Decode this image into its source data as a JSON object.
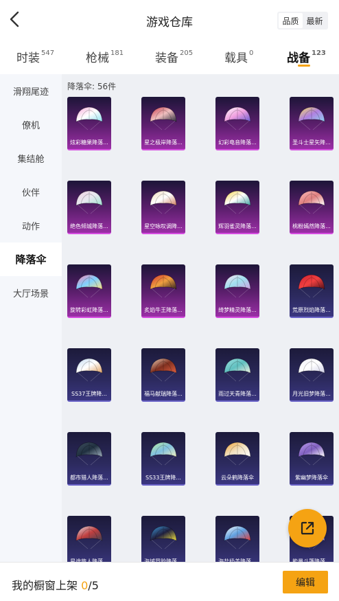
{
  "header": {
    "title": "游戏仓库",
    "sort": [
      "品质",
      "最新"
    ]
  },
  "tabs": [
    {
      "label": "时装",
      "count": "547"
    },
    {
      "label": "枪械",
      "count": "181"
    },
    {
      "label": "装备",
      "count": "205"
    },
    {
      "label": "载具",
      "count": "0"
    },
    {
      "label": "战备",
      "count": "123"
    }
  ],
  "sidebar": [
    {
      "label": "滑翔尾迹"
    },
    {
      "label": "僚机"
    },
    {
      "label": "集结舱"
    },
    {
      "label": "伙伴"
    },
    {
      "label": "动作"
    },
    {
      "label": "降落伞"
    },
    {
      "label": "大厅场景"
    }
  ],
  "content": {
    "count_label": "降落伞: 56件",
    "items": [
      {
        "name": "炫彩糖果降落...",
        "rarity": "purple"
      },
      {
        "name": "星之极岸降落...",
        "rarity": "purple"
      },
      {
        "name": "幻彩电音降落...",
        "rarity": "purple"
      },
      {
        "name": "圣斗士星矢降...",
        "rarity": "purple"
      },
      {
        "name": "绝色倾城降落...",
        "rarity": "purple"
      },
      {
        "name": "星空咏叹调降...",
        "rarity": "purple"
      },
      {
        "name": "辉羽雀灵降落...",
        "rarity": "purple"
      },
      {
        "name": "桃粉嫣然降落...",
        "rarity": "purple"
      },
      {
        "name": "旋转彩虹降落...",
        "rarity": "purple"
      },
      {
        "name": "炙焰牛王降落...",
        "rarity": "purple"
      },
      {
        "name": "绮梦精灵降落...",
        "rarity": "purple"
      },
      {
        "name": "荒原烈焰降落...",
        "rarity": "blue"
      },
      {
        "name": "SS37王牌降...",
        "rarity": "blue"
      },
      {
        "name": "福马献瑞降落...",
        "rarity": "blue"
      },
      {
        "name": "雨过天青降落...",
        "rarity": "blue"
      },
      {
        "name": "月光旧梦降落...",
        "rarity": "blue"
      },
      {
        "name": "都市猎人降落...",
        "rarity": "blue"
      },
      {
        "name": "SS33王牌降...",
        "rarity": "blue"
      },
      {
        "name": "云朵鹤降落伞",
        "rarity": "blue"
      },
      {
        "name": "紫幽梦降落伞",
        "rarity": "blue"
      },
      {
        "name": "星途旅人降落...",
        "rarity": "blue"
      },
      {
        "name": "海域冒险降落...",
        "rarity": "blue"
      },
      {
        "name": "海盐奶盖降落...",
        "rarity": "blue"
      },
      {
        "name": "能量斗篷降落...",
        "rarity": "blue"
      }
    ]
  },
  "footer": {
    "label": "我的橱窗上架",
    "current": "0",
    "total": "/5",
    "edit": "编辑"
  },
  "colors": {
    "accent": "#f5a313",
    "purple_rarity": "#9b2fa6",
    "blue_rarity": "#3a3680"
  },
  "icons": {
    "back": "chevron-left-icon",
    "share": "share-external-icon"
  }
}
